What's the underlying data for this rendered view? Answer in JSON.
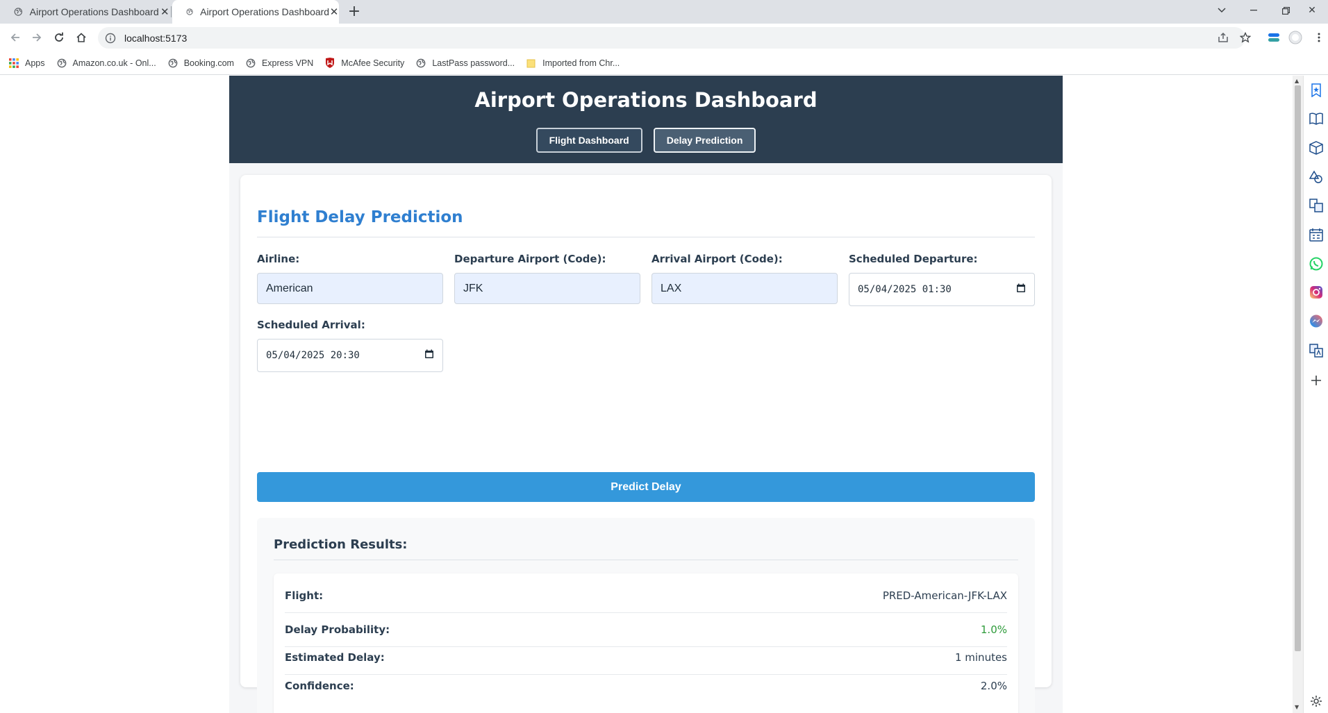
{
  "browser": {
    "tabs": [
      {
        "title": "Airport Operations Dashboard",
        "active": false
      },
      {
        "title": "Airport Operations Dashboard",
        "active": true
      }
    ],
    "url": "localhost:5173",
    "bookmarks": [
      {
        "label": "Apps",
        "icon": "apps-grid-icon"
      },
      {
        "label": "Amazon.co.uk - Onl...",
        "icon": "globe-icon"
      },
      {
        "label": "Booking.com",
        "icon": "globe-icon"
      },
      {
        "label": "Express VPN",
        "icon": "globe-icon"
      },
      {
        "label": "McAfee Security",
        "icon": "mcafee-shield-icon"
      },
      {
        "label": "LastPass password...",
        "icon": "globe-icon"
      },
      {
        "label": "Imported from Chr...",
        "icon": "folder-icon"
      }
    ]
  },
  "app": {
    "title": "Airport Operations Dashboard",
    "nav": {
      "flight_dashboard": "Flight Dashboard",
      "delay_prediction": "Delay Prediction",
      "active": "delay_prediction"
    },
    "form": {
      "heading": "Flight Delay Prediction",
      "airline_label": "Airline:",
      "airline_value": "American",
      "departure_label": "Departure Airport (Code):",
      "departure_value": "JFK",
      "arrival_label": "Arrival Airport (Code):",
      "arrival_value": "LAX",
      "sched_departure_label": "Scheduled Departure:",
      "sched_departure_value": "05/04/2025 01:30",
      "sched_arrival_label": "Scheduled Arrival:",
      "sched_arrival_value": "05/04/2025 20:30",
      "submit_label": "Predict Delay"
    },
    "results": {
      "heading": "Prediction Results:",
      "rows": [
        {
          "label": "Flight:",
          "value": "PRED-American-JFK-LAX"
        },
        {
          "label": "Delay Probability:",
          "value": "1.0%"
        },
        {
          "label": "Estimated Delay:",
          "value": "1 minutes"
        },
        {
          "label": "Confidence:",
          "value": "2.0%"
        }
      ]
    }
  },
  "colors": {
    "header_bg": "#2c3e50",
    "accent_blue": "#3498db",
    "heading_blue": "#2f7fd0",
    "probability_green": "#2e9b3a"
  }
}
